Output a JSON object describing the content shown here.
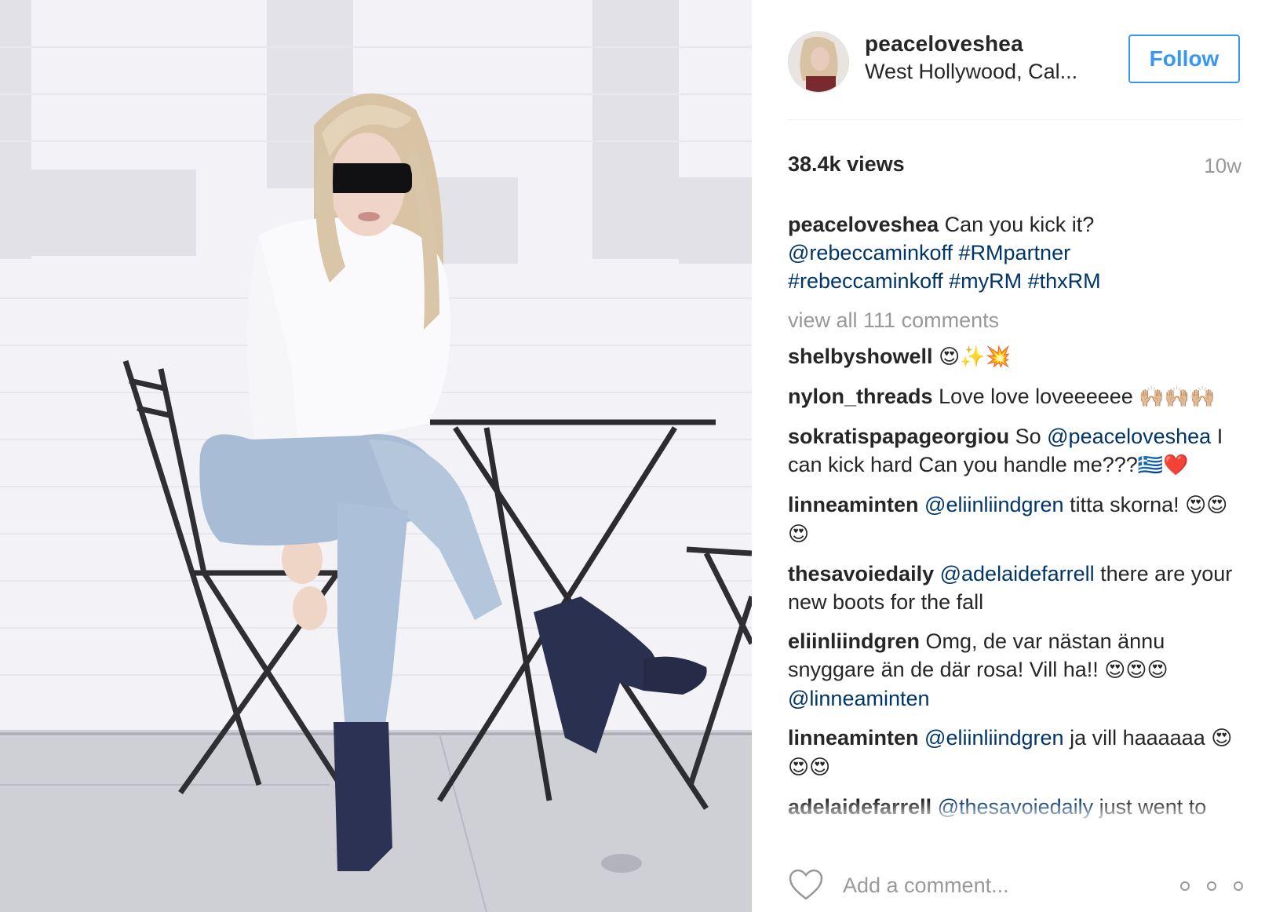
{
  "post": {
    "username": "peaceloveshea",
    "location": "West Hollywood, Cal...",
    "follow_label": "Follow",
    "views": "38.4k views",
    "age": "10w",
    "media_description_icon": "photo",
    "caption": {
      "text": "Can you kick it?",
      "tags": [
        "@rebeccaminkoff",
        "#RMpartner",
        "#rebeccaminkoff",
        "#myRM",
        "#thxRM"
      ]
    },
    "view_all": "view all 111 comments"
  },
  "comments": [
    {
      "user": "shelbyshowell",
      "text": "",
      "emoji": "😍✨💥"
    },
    {
      "user": "nylon_threads",
      "text": "Love love loveeeeee",
      "emoji": "🙌🏼🙌🏼🙌🏼"
    },
    {
      "user": "sokratispapageorgiou",
      "text_a": "So",
      "mention": "@peaceloveshea",
      "text_b": "I can kick hard Can you handle me???",
      "emoji": "🇬🇷❤️"
    },
    {
      "user": "linneaminten",
      "mention": "@eliinliindgren",
      "text": "titta skorna!",
      "emoji": "😍😍😍"
    },
    {
      "user": "thesavoiedaily",
      "mention": "@adelaidefarrell",
      "text": "there are your new boots for the fall"
    },
    {
      "user": "eliinliindgren",
      "text": "Omg, de var nästan ännu snyggare än de där rosa! Vill ha!!",
      "emoji": "😍😍😍",
      "mention": "@linneaminten"
    },
    {
      "user": "linneaminten",
      "mention": "@eliinliindgren",
      "text": "ja vill haaaaaa",
      "emoji": "😍😍😍"
    },
    {
      "user": "adelaidefarrell",
      "mention": "@thesavoiedaily",
      "text": "just went to"
    }
  ],
  "footer": {
    "comment_placeholder": "Add a comment...",
    "like_icon": "heart-outline-icon",
    "more_icon": "more-options-icon"
  },
  "colors": {
    "follow": "#3897f0",
    "link": "#003569",
    "muted": "#999999",
    "text": "#262626"
  }
}
